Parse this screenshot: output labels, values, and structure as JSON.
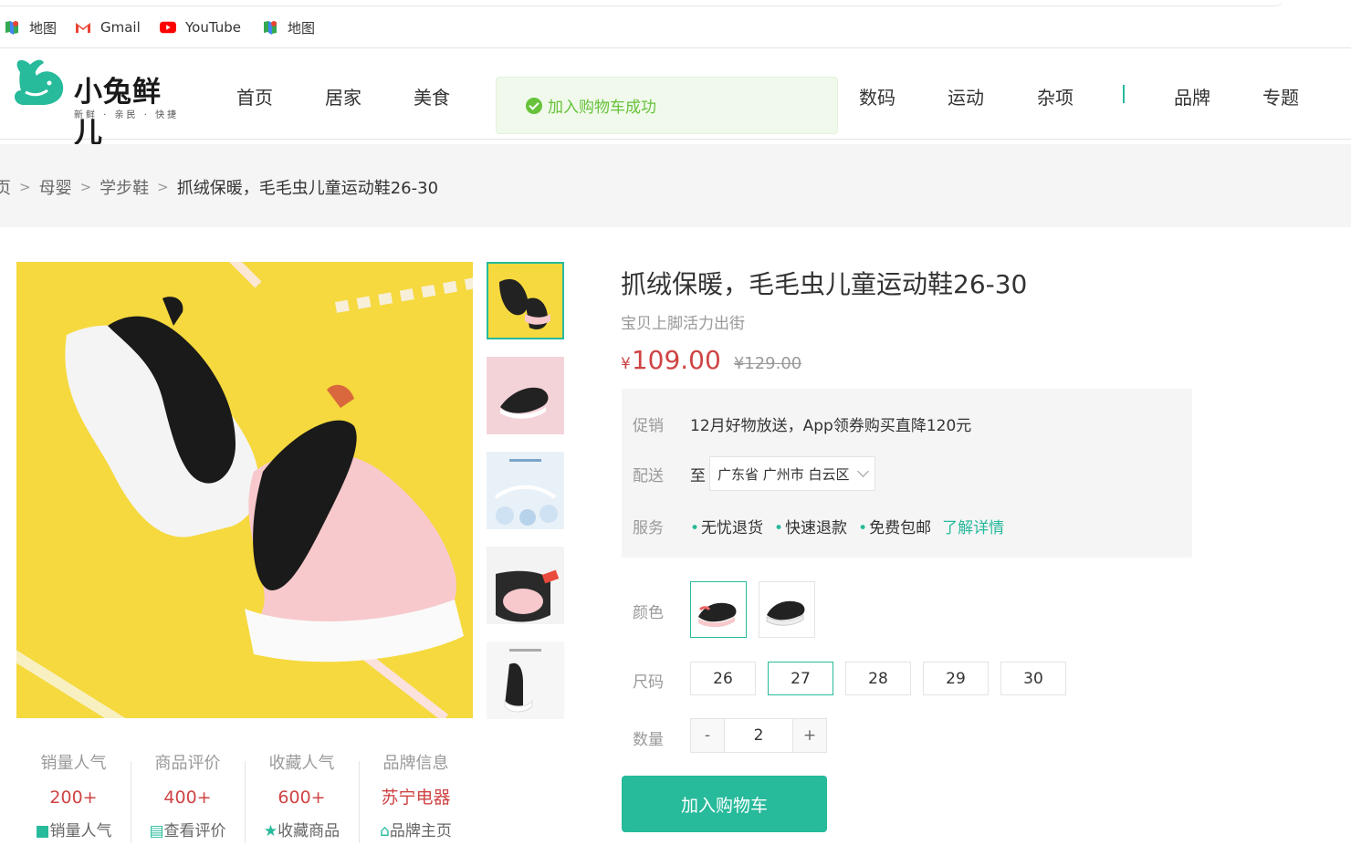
{
  "bookmarks": [
    {
      "label": "地图",
      "icon": "maps-icon"
    },
    {
      "label": "Gmail",
      "icon": "gmail-icon"
    },
    {
      "label": "YouTube",
      "icon": "youtube-icon"
    },
    {
      "label": "地图",
      "icon": "maps-icon"
    }
  ],
  "brand": {
    "name": "小兔鲜儿",
    "tagline": "新鲜 · 亲民 · 快捷",
    "accent": "#27ba9b"
  },
  "nav": [
    "首页",
    "居家",
    "美食",
    "数码",
    "运动",
    "杂项",
    "品牌",
    "专题"
  ],
  "toast": {
    "message": "加入购物车成功",
    "color": "#67c23a"
  },
  "breadcrumb": [
    "页",
    "母婴",
    "学步鞋",
    "抓绒保暖，毛毛虫儿童运动鞋26-30"
  ],
  "product": {
    "title": "抓绒保暖，毛毛虫儿童运动鞋26-30",
    "subtitle": "宝贝上脚活力出街",
    "currency": "¥",
    "price": "109.00",
    "old_price": "¥129.00",
    "price_color": "#cf4444"
  },
  "promo": {
    "promo_label": "促销",
    "promo_text": "12月好物放送，App领券购买直降120元",
    "ship_label": "配送",
    "ship_to": "至",
    "address": "广东省 广州市 白云区",
    "service_label": "服务",
    "services": [
      "无忧退货",
      "快速退款",
      "免费包邮"
    ],
    "more": "了解详情"
  },
  "specs": {
    "color_label": "颜色",
    "size_label": "尺码",
    "sizes": [
      "26",
      "27",
      "28",
      "29",
      "30"
    ],
    "selected_size": "27",
    "qty_label": "数量",
    "qty": "2",
    "minus": "-",
    "plus": "+"
  },
  "cart_button": "加入购物车",
  "stats": [
    {
      "label": "销量人气",
      "value": "200+",
      "link": "销量人气",
      "icon": "bar-icon"
    },
    {
      "label": "商品评价",
      "value": "400+",
      "link": "查看评价",
      "icon": "comment-icon"
    },
    {
      "label": "收藏人气",
      "value": "600+",
      "link": "收藏商品",
      "icon": "star-icon"
    },
    {
      "label": "品牌信息",
      "value": "苏宁电器",
      "link": "品牌主页",
      "icon": "home-icon"
    }
  ]
}
